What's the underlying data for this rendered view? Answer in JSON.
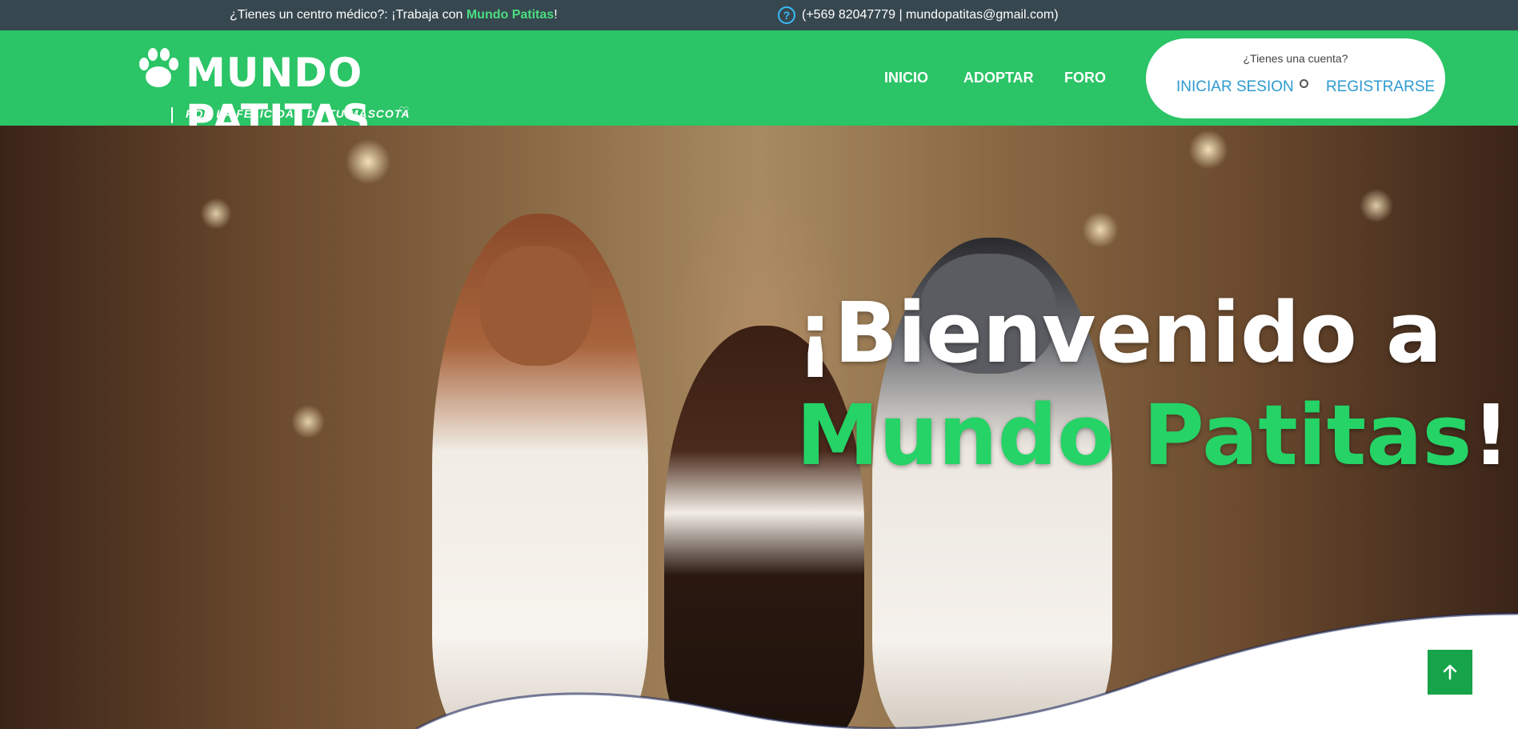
{
  "topbar": {
    "promo_prefix": "¿Tienes un centro médico?: ¡Trabaja con ",
    "promo_brand": "Mundo Patitas",
    "promo_suffix": "!",
    "contact_icon": "question-circle-icon",
    "contact_text": "(+569 82047779 | mundopatitas@gmail.com)"
  },
  "logo": {
    "name": "MUNDO PATITAS",
    "tagline": "POR LA FELICIDAD DE TU MASCOTA",
    "paw_icon": "paw-icon",
    "heart_icon": "heart-outline-icon"
  },
  "nav": {
    "items": [
      {
        "label": "INICIO"
      },
      {
        "label": "ADOPTAR"
      },
      {
        "label": "FORO"
      }
    ]
  },
  "account": {
    "question": "¿Tienes una cuenta?",
    "login_label": "INICIAR SESION",
    "register_label": "REGISTRARSE"
  },
  "hero": {
    "line1": "¡Bienvenido a",
    "brand": "Mundo Patitas",
    "exclaim": "!"
  },
  "scroll_top": {
    "icon": "arrow-up-icon"
  },
  "colors": {
    "topbar_bg": "#37474f",
    "header_green": "#2bc466",
    "brand_green": "#25d366",
    "link_blue": "#2e9bd0",
    "scroll_button": "#16a34a"
  }
}
